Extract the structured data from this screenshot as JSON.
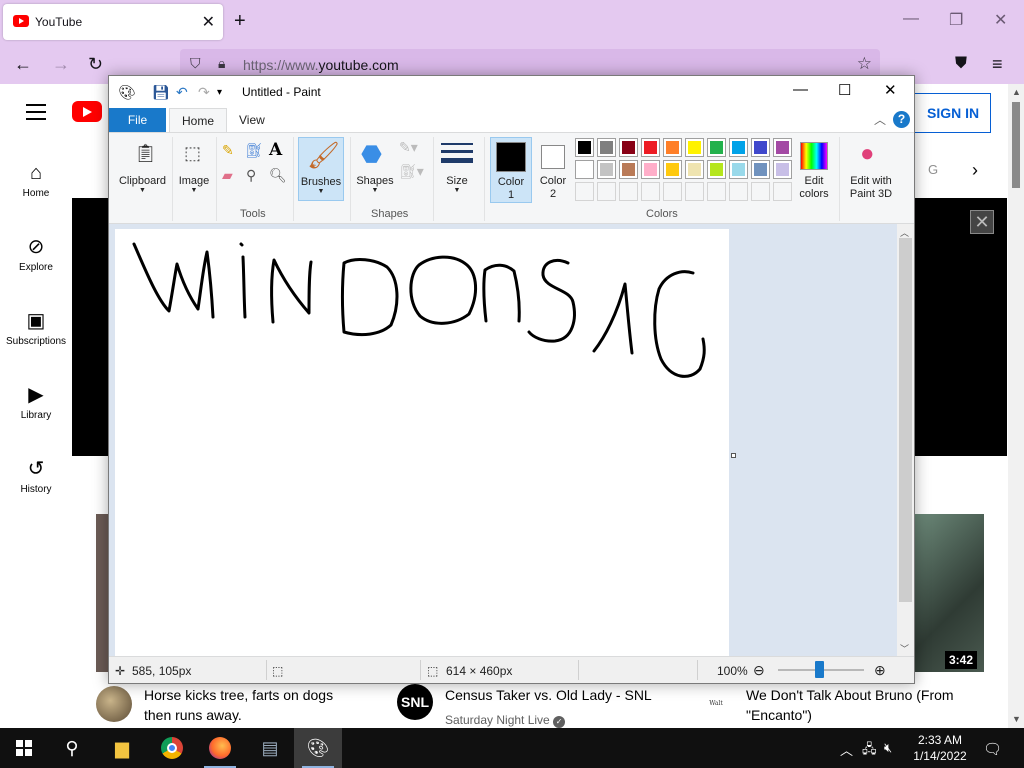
{
  "browser": {
    "tab_title": "YouTube",
    "url_dim": "https://www.",
    "url_main": "youtube.com"
  },
  "youtube": {
    "nav": [
      {
        "label": "Home",
        "icon": "home-icon"
      },
      {
        "label": "Explore",
        "icon": "compass-icon"
      },
      {
        "label": "Subscriptions",
        "icon": "subscriptions-icon"
      },
      {
        "label": "Library",
        "icon": "library-icon"
      },
      {
        "label": "History",
        "icon": "history-icon"
      }
    ],
    "sign_in": "SIGN IN",
    "chip_fragment": "G",
    "duration": "3:42",
    "videos": [
      {
        "title_line1": "Horse kicks tree, farts on dogs",
        "title_line2": "then runs away.",
        "channel": ""
      },
      {
        "title_line1": "Census Taker vs. Old Lady - SNL",
        "title_line2": "",
        "channel": "Saturday Night Live",
        "avatar_text": "SNL"
      },
      {
        "title_line1": "We Don't Talk About Bruno (From",
        "title_line2": "\"Encanto\")",
        "channel": "",
        "avatar_text": "Walt Disney"
      }
    ]
  },
  "paint": {
    "title": "Untitled - Paint",
    "tabs": {
      "file": "File",
      "home": "Home",
      "view": "View"
    },
    "groups": {
      "clipboard": "Clipboard",
      "image": "Image",
      "tools": "Tools",
      "brushes": "Brushes",
      "shapes_btn": "Shapes",
      "shapes_group": "Shapes",
      "size": "Size",
      "color1_l1": "Color",
      "color1_l2": "1",
      "color2_l1": "Color",
      "color2_l2": "2",
      "edit_colors_l1": "Edit",
      "edit_colors_l2": "colors",
      "paint3d_l1": "Edit with",
      "paint3d_l2": "Paint 3D",
      "colors": "Colors"
    },
    "palette_row1": [
      "#000000",
      "#7f7f7f",
      "#880015",
      "#ed1c24",
      "#ff7f27",
      "#fff200",
      "#22b14c",
      "#00a2e8",
      "#3f48cc",
      "#a349a4"
    ],
    "palette_row2": [
      "#ffffff",
      "#c3c3c3",
      "#b97a57",
      "#ffaec9",
      "#ffc90e",
      "#efe4b0",
      "#b5e61d",
      "#99d9ea",
      "#7092be",
      "#c8bfe7"
    ],
    "color1": "#000000",
    "color2": "#ffffff",
    "status": {
      "cursor": "585, 105px",
      "canvas_size": "614 × 460px",
      "zoom": "100%"
    }
  },
  "taskbar": {
    "time": "2:33 AM",
    "date": "1/14/2022"
  }
}
